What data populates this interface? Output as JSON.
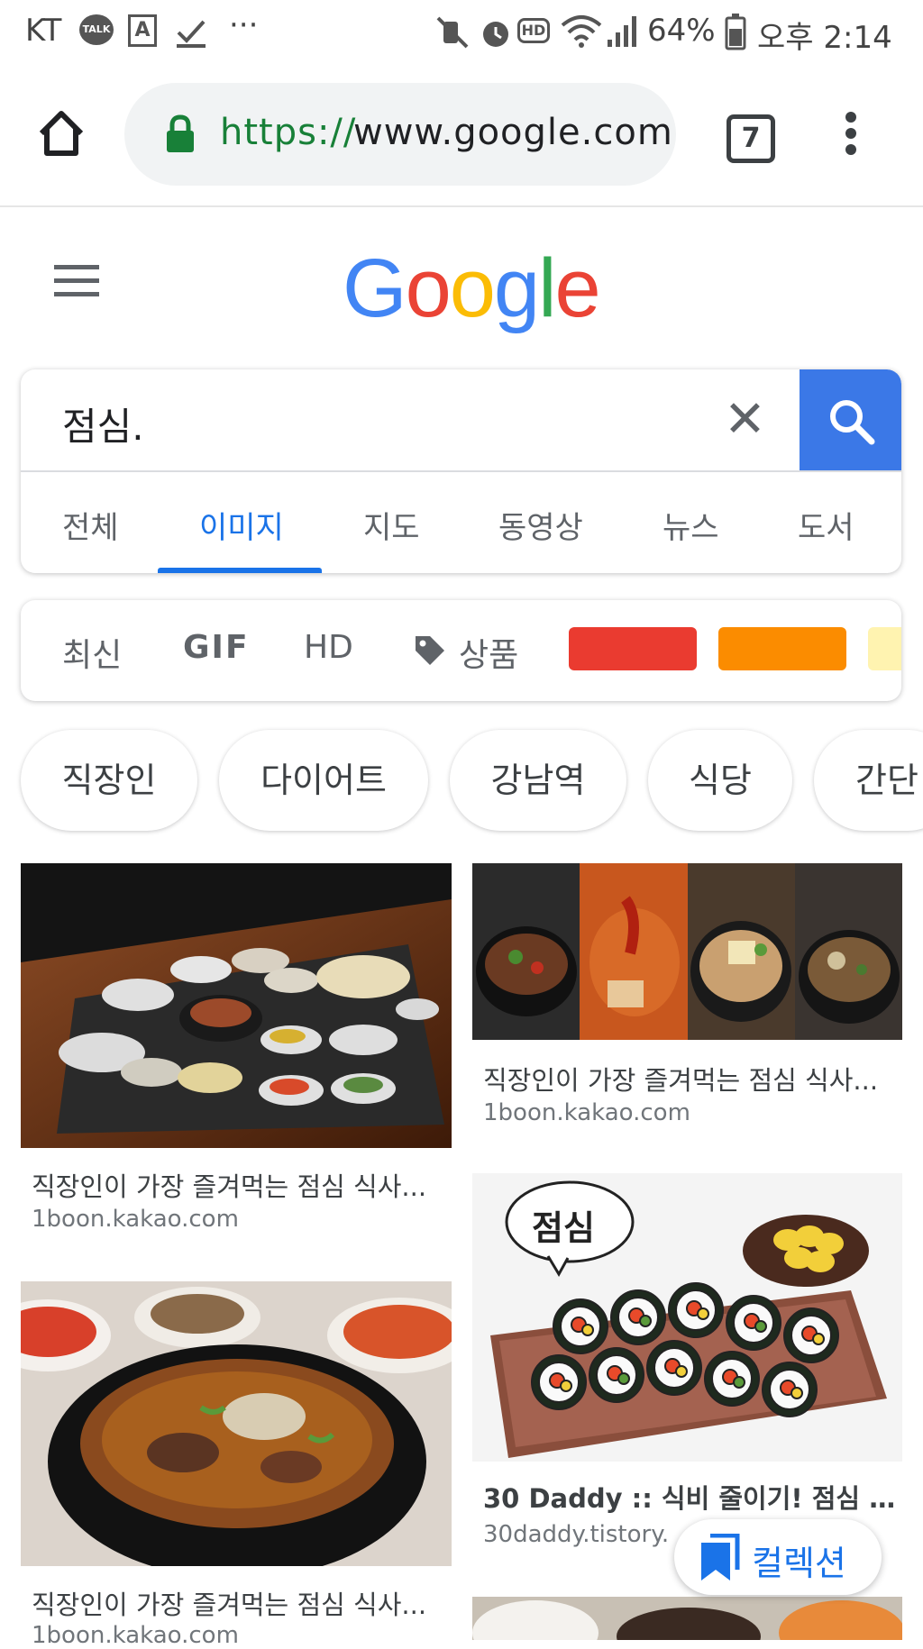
{
  "status_bar": {
    "carrier": "KT",
    "talk_badge": "TALK",
    "battery": "64%",
    "time": "오후 2:14",
    "hd_badge": "HD"
  },
  "browser": {
    "url_scheme": "https://",
    "url_host": "www.google.com",
    "tab_count": "7"
  },
  "google": {
    "logo_letters": [
      {
        "ch": "G",
        "color": "#4285f4"
      },
      {
        "ch": "o",
        "color": "#ea4335"
      },
      {
        "ch": "o",
        "color": "#fbbc05"
      },
      {
        "ch": "g",
        "color": "#4285f4"
      },
      {
        "ch": "l",
        "color": "#34a853"
      },
      {
        "ch": "e",
        "color": "#ea4335"
      }
    ]
  },
  "search": {
    "query": "점심.",
    "accent": "#3b78e7"
  },
  "tabs": {
    "all": "전체",
    "images": "이미지",
    "maps": "지도",
    "videos": "동영상",
    "news": "뉴스",
    "books": "도서",
    "active": "images"
  },
  "tools": {
    "recent": "최신",
    "gif": "GIF",
    "hd": "HD",
    "products": "상품",
    "color_swatches": [
      "#ea3b30",
      "#fb8c00",
      "#fff3b0"
    ]
  },
  "chips": [
    "직장인",
    "다이어트",
    "강남역",
    "식당",
    "간단"
  ],
  "results": {
    "r1": {
      "title": "직장인이 가장 즐겨먹는 점심 식사...",
      "domain": "1boon.kakao.com"
    },
    "r2": {
      "title": "직장인이 가장 즐겨먹는 점심 식사...",
      "domain": "1boon.kakao.com"
    },
    "r3": {
      "title": "30 Daddy :: 식비 줄이기! 점심 밥...",
      "domain": "30daddy.tistory.",
      "image_text": "점심"
    },
    "r4": {
      "title": "직장인이 가장 즐겨먹는 점심 식사...",
      "domain": "1boon.kakao.com"
    }
  },
  "collection": {
    "label": "컬렉션"
  }
}
